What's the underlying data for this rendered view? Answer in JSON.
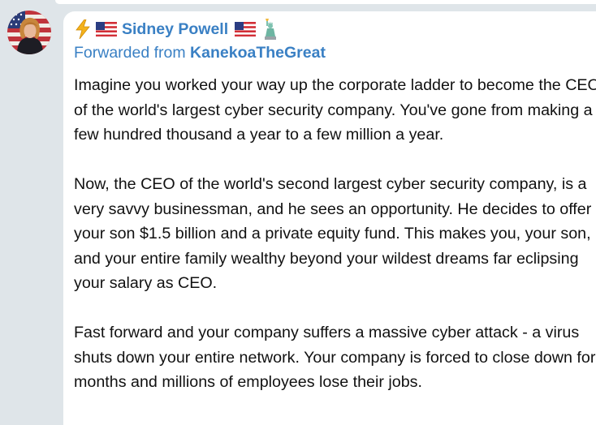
{
  "message": {
    "sender": {
      "name": "Sidney Powell",
      "prefix_icons": [
        "lightning-icon",
        "us-flag-icon"
      ],
      "suffix_icons": [
        "us-flag-icon",
        "statue-of-liberty-icon"
      ]
    },
    "forwarded": {
      "prefix": "Forwarded from",
      "source": "KanekoaTheGreat"
    },
    "paragraphs": [
      "Imagine you worked your way up the corporate ladder to become the CEO of the world's largest cyber security company. You've gone from making a few hundred thousand a year to a few million a year.",
      "Now, the CEO of the world's second largest cyber security company, is a very savvy businessman, and he sees an opportunity. He decides to offer your son $1.5 billion and a private equity fund. This makes you, your son, and your entire family wealthy beyond your wildest dreams far eclipsing your salary as CEO.",
      "Fast forward and your company suffers a massive cyber attack - a virus shuts down your entire network. Your company is forced to close down for months and millions of employees lose their jobs."
    ]
  },
  "colors": {
    "background": "#dfe5e9",
    "bubble": "#ffffff",
    "accent": "#3a80c4",
    "text": "#111111"
  }
}
